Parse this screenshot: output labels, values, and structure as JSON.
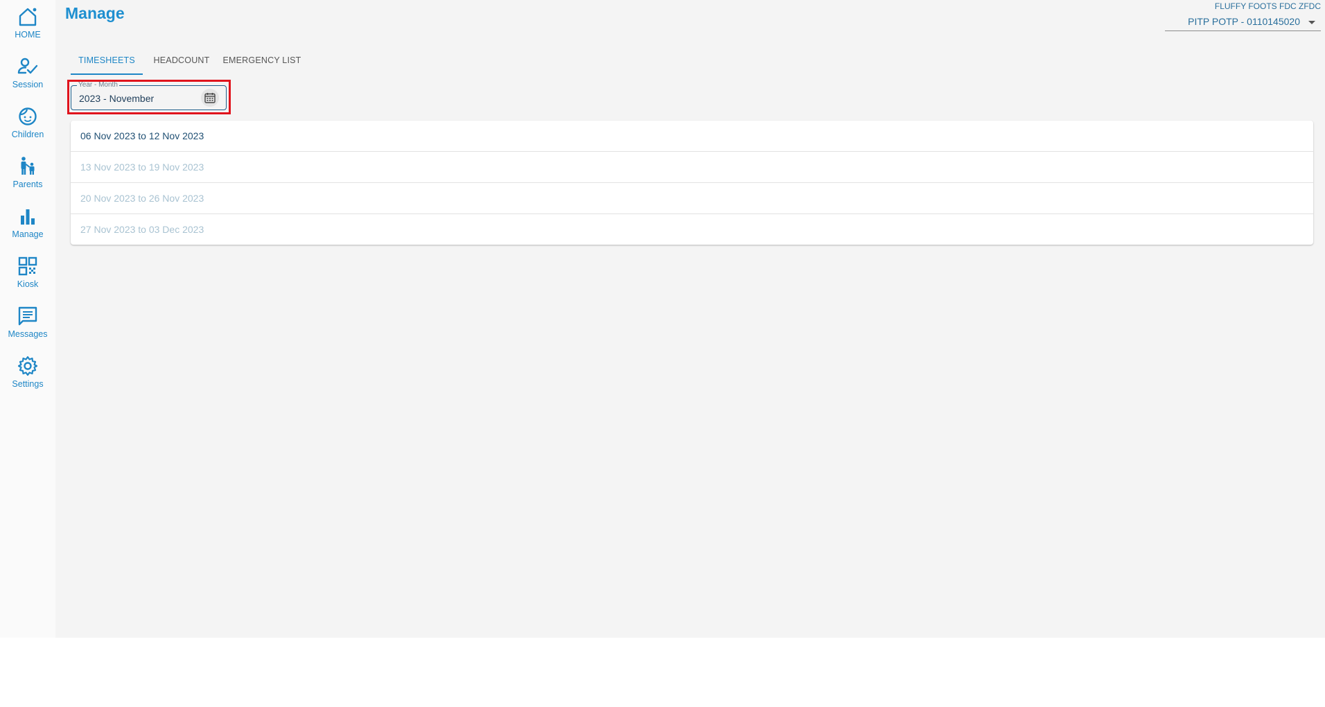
{
  "colors": {
    "accent": "#1e86c6",
    "title": "#1e8fd0",
    "highlight_border": "#e0141d",
    "row_enabled": "#1f4f73",
    "row_disabled": "#a9c3d2"
  },
  "sidebar": {
    "items": [
      {
        "label": "HOME",
        "icon": "home-icon"
      },
      {
        "label": "Session",
        "icon": "person-check-icon"
      },
      {
        "label": "Children",
        "icon": "child-face-icon"
      },
      {
        "label": "Parents",
        "icon": "parent-child-icon"
      },
      {
        "label": "Manage",
        "icon": "bar-chart-icon"
      },
      {
        "label": "Kiosk",
        "icon": "qr-code-icon"
      },
      {
        "label": "Messages",
        "icon": "message-icon"
      },
      {
        "label": "Settings",
        "icon": "gear-icon"
      }
    ]
  },
  "header": {
    "title": "Manage",
    "org_name": "FLUFFY FOOTS FDC ZFDC",
    "org_selector": "PITP POTP - 0110145020"
  },
  "tabs": [
    {
      "label": "TIMESHEETS",
      "active": true
    },
    {
      "label": "HEADCOUNT",
      "active": false
    },
    {
      "label": "EMERGENCY LIST",
      "active": false
    }
  ],
  "date_field": {
    "label": "Year - Month",
    "value": "2023 - November"
  },
  "weeks": [
    {
      "label": "06 Nov 2023 to 12 Nov 2023",
      "enabled": true
    },
    {
      "label": "13 Nov 2023 to 19 Nov 2023",
      "enabled": false
    },
    {
      "label": "20 Nov 2023 to 26 Nov 2023",
      "enabled": false
    },
    {
      "label": "27 Nov 2023 to 03 Dec 2023",
      "enabled": false
    }
  ]
}
